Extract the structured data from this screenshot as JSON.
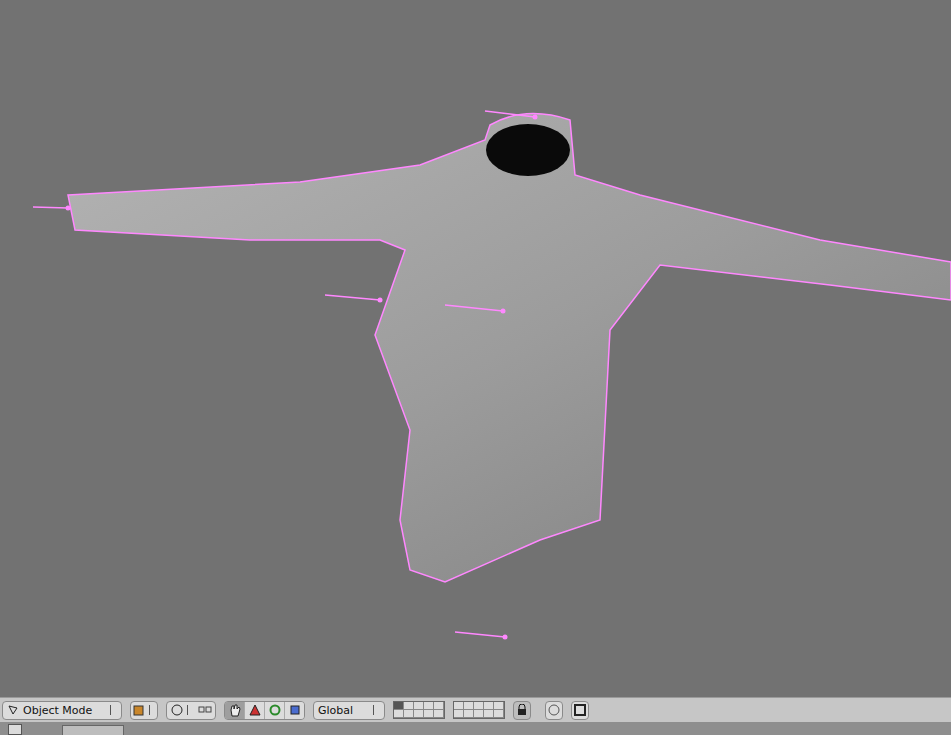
{
  "viewport": {
    "objects": [
      {
        "kind": "mesh"
      },
      {
        "kind": "lamp"
      },
      {
        "kind": "lamp"
      },
      {
        "kind": "lamp"
      },
      {
        "kind": "lamp"
      },
      {
        "kind": "lamp"
      }
    ]
  },
  "header": {
    "mode_menu": {
      "label": "Object Mode"
    },
    "manipulator_tools": [
      {
        "kind": "hand",
        "selected": true
      },
      {
        "kind": "translate",
        "selected": false
      },
      {
        "kind": "rotate",
        "selected": false
      },
      {
        "kind": "scale",
        "selected": false
      }
    ],
    "orientation_menu": {
      "label": "Global"
    },
    "layers": [
      {
        "selected": true
      },
      {
        "selected": false
      },
      {
        "selected": false
      },
      {
        "selected": false
      },
      {
        "selected": false
      },
      {
        "selected": false
      },
      {
        "selected": false
      },
      {
        "selected": false
      },
      {
        "selected": false
      },
      {
        "selected": false
      },
      {
        "selected": false
      },
      {
        "selected": false
      },
      {
        "selected": false
      },
      {
        "selected": false
      },
      {
        "selected": false
      },
      {
        "selected": false
      },
      {
        "selected": false
      },
      {
        "selected": false
      },
      {
        "selected": false
      },
      {
        "selected": false
      }
    ],
    "lock": {
      "on": true
    }
  }
}
